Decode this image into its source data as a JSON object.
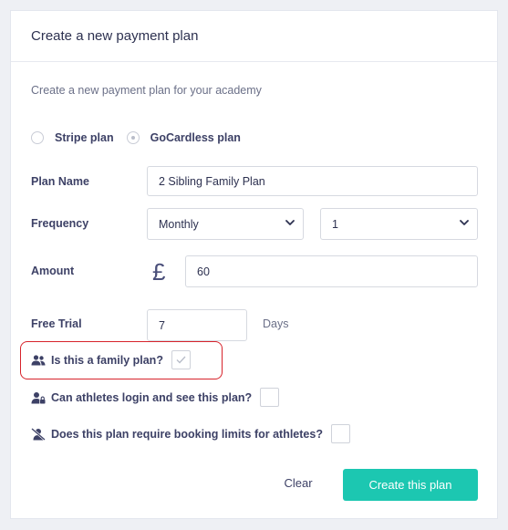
{
  "header": {
    "title": "Create a new payment plan"
  },
  "subtitle": "Create a new payment plan for your academy",
  "plan_types": [
    {
      "label": "Stripe plan",
      "selected": false
    },
    {
      "label": "GoCardless plan",
      "selected": true
    }
  ],
  "form": {
    "plan_name": {
      "label": "Plan Name",
      "value": "2 Sibling Family Plan"
    },
    "frequency": {
      "label": "Frequency",
      "unit_value": "Monthly",
      "count_value": "1"
    },
    "amount": {
      "label": "Amount",
      "currency_symbol": "£",
      "value": "60"
    },
    "free_trial": {
      "label": "Free Trial",
      "value": "7",
      "suffix": "Days"
    }
  },
  "options": {
    "family_plan": {
      "label": "Is this a family plan?",
      "checked": true,
      "icon": "users-icon"
    },
    "athletes_login": {
      "label": "Can athletes login and see this plan?",
      "checked": false,
      "icon": "user-lock-icon"
    },
    "booking_limits": {
      "label": "Does this plan require booking limits for athletes?",
      "checked": false,
      "icon": "user-slash-icon"
    }
  },
  "actions": {
    "clear_label": "Clear",
    "create_label": "Create this plan"
  },
  "colors": {
    "accent": "#1cc7b1",
    "highlight": "#d7232b",
    "text": "#3d4166"
  }
}
